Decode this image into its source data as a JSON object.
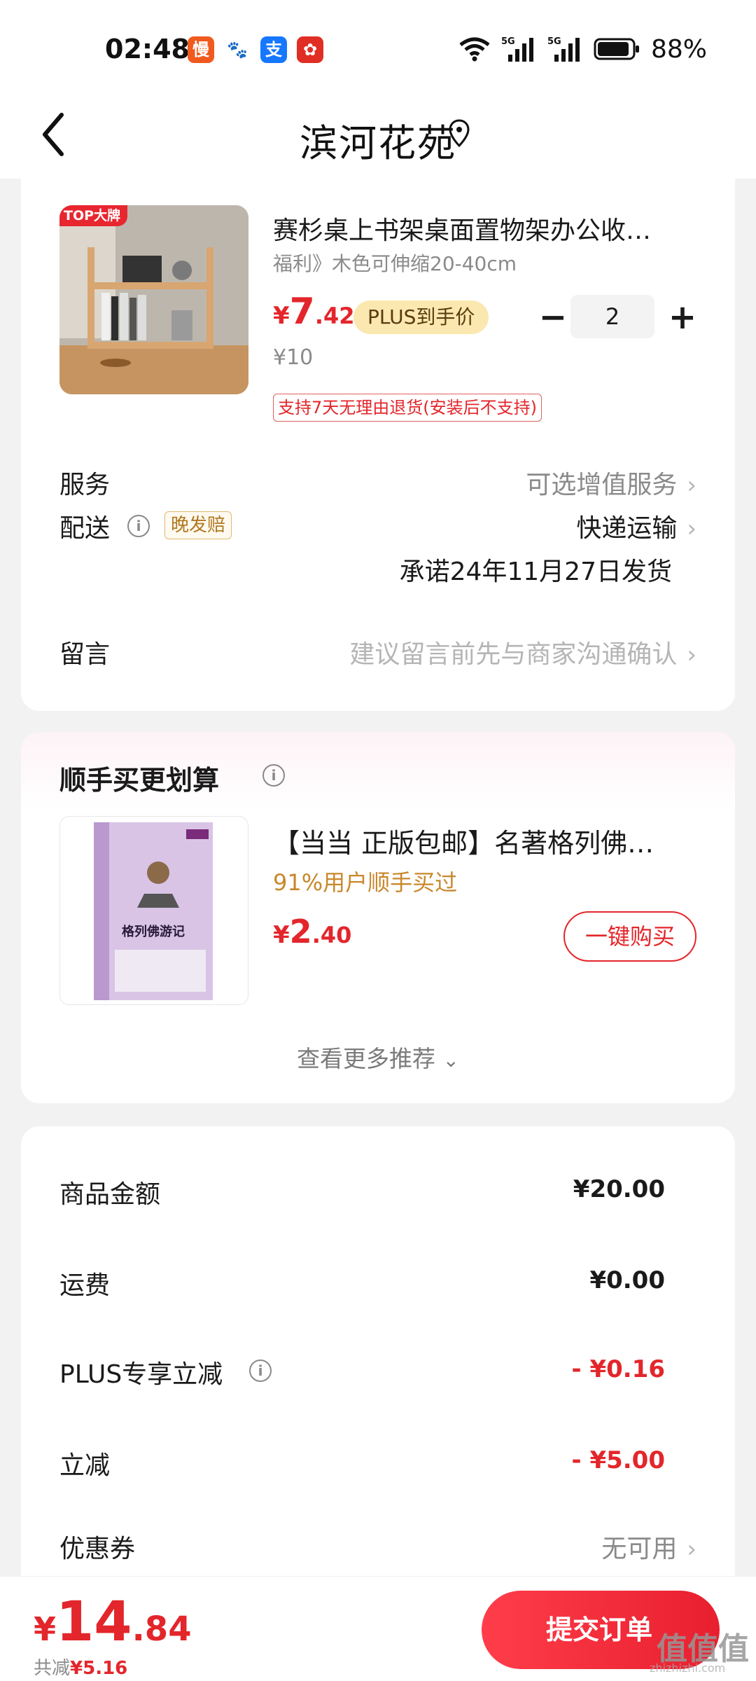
{
  "status_bar": {
    "time": "02:48",
    "app_icons": [
      {
        "name": "taobao-special-icon",
        "glyph": "慢",
        "color": "#f05a1f"
      },
      {
        "name": "baidu-icon",
        "glyph": "🐾",
        "color": "#ffffff"
      },
      {
        "name": "alipay-icon",
        "glyph": "支",
        "color": "#1677ff"
      },
      {
        "name": "pdd-icon",
        "glyph": "✿",
        "color": "#e02e24"
      }
    ],
    "battery": "88%"
  },
  "header": {
    "title": "滨河花苑"
  },
  "product": {
    "badge": "TOP大牌",
    "title": "赛杉桌上书架桌面置物架办公收…",
    "spec": "福利》木色可伸缩20-40cm",
    "price_symbol": "¥",
    "price_int": "7",
    "price_dec": ".42",
    "plus_tag": "PLUS到手价",
    "quantity": "2",
    "original_price": "¥10",
    "return_tag": "支持7天无理由退货(安装后不支持)"
  },
  "service": {
    "label": "服务",
    "value": "可选增值服务"
  },
  "delivery": {
    "label": "配送",
    "late_tag": "晚发赔",
    "value": "快递运输",
    "promise": "承诺24年11月27日发货"
  },
  "message": {
    "label": "留言",
    "placeholder": "建议留言前先与商家沟通确认"
  },
  "recommend": {
    "title": "顺手买更划算",
    "item_name": "【当当 正版包邮】名著格列佛…",
    "item_sub": "91%用户顺手买过",
    "price_symbol": "¥",
    "price_int": "2",
    "price_dec": ".40",
    "buy_label": "一键购买",
    "more_label": "查看更多推荐",
    "book_title": "格列佛游记"
  },
  "summary": {
    "goods_label": "商品金额",
    "goods_value": "¥20.00",
    "shipping_label": "运费",
    "shipping_value": "¥0.00",
    "plus_discount_label": "PLUS专享立减",
    "plus_discount_value": "- ¥0.16",
    "discount_label": "立减",
    "discount_value": "- ¥5.00",
    "coupon_label": "优惠券",
    "coupon_value": "无可用"
  },
  "bottom_bar": {
    "price_symbol": "¥",
    "total_int": "14",
    "total_dec": ".84",
    "saved_label": "共减",
    "saved_value": "¥5.16",
    "submit_label": "提交订单"
  },
  "watermark": {
    "text": "值值值",
    "sub": "zhizhizhi.com"
  },
  "colors": {
    "accent_red": "#e3262b",
    "plus_gold": "#fbe8b0",
    "reco_orange": "#c8882c"
  }
}
